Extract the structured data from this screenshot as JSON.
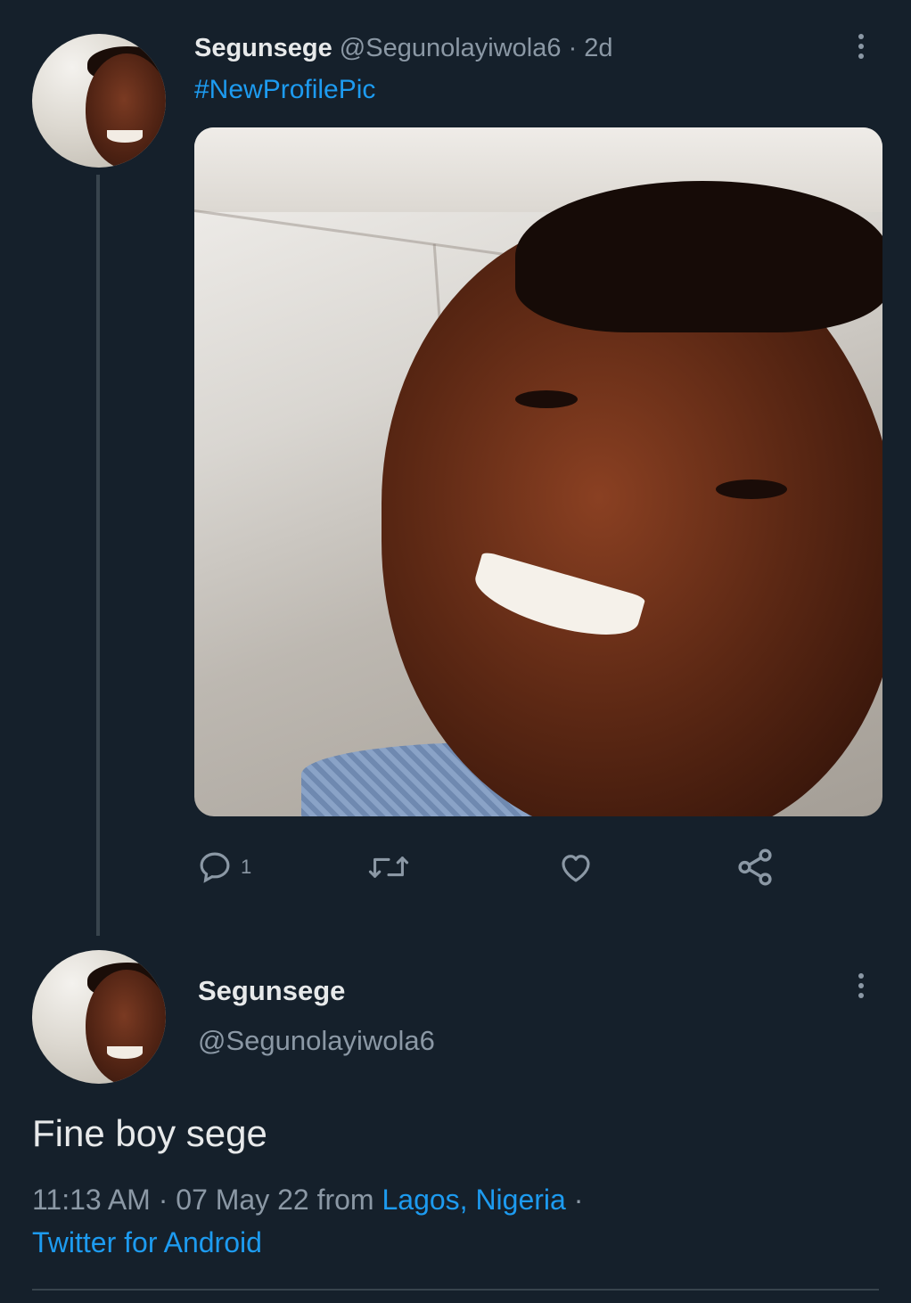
{
  "parent_tweet": {
    "display_name": "Segunsege",
    "handle": "@Segunolayiwola6",
    "separator": "·",
    "age": "2d",
    "hashtag": "#NewProfilePic",
    "actions": {
      "reply_count": "1"
    }
  },
  "reply_tweet": {
    "display_name": "Segunsege",
    "handle": "@Segunolayiwola6",
    "text": "Fine boy sege",
    "time": "11:13 AM",
    "sep1": "·",
    "date": "07 May 22",
    "from_label": "from",
    "location": "Lagos, Nigeria",
    "sep2": "·",
    "source": "Twitter for Android"
  },
  "colors": {
    "background": "#15202b",
    "accent": "#1d9bf0",
    "muted": "#8b98a5",
    "text": "#e7e9ea"
  },
  "icons": [
    "reply-icon",
    "retweet-icon",
    "like-icon",
    "share-icon",
    "more-icon"
  ]
}
